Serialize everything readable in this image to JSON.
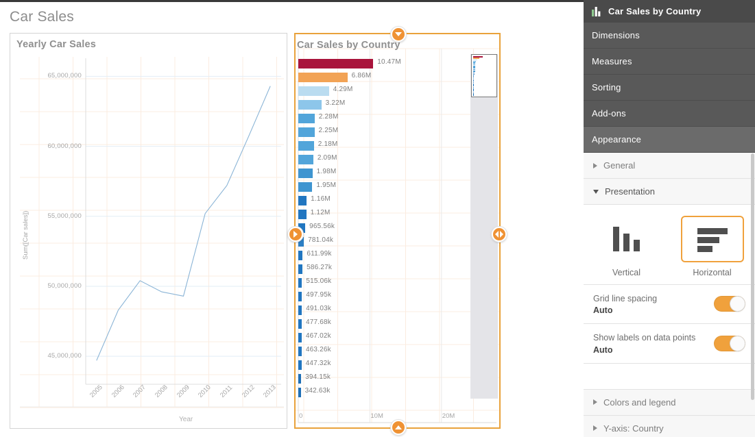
{
  "sheet": {
    "title": "Car Sales"
  },
  "line_object": {
    "title": "Yearly Car Sales"
  },
  "bar_object": {
    "title": "Car Sales by Country"
  },
  "panel": {
    "header_title": "Car Sales by Country",
    "header_icon": "bar-chart-icon",
    "accordion": [
      {
        "label": "Dimensions",
        "active": false
      },
      {
        "label": "Measures",
        "active": false
      },
      {
        "label": "Sorting",
        "active": false
      },
      {
        "label": "Add-ons",
        "active": false
      },
      {
        "label": "Appearance",
        "active": true
      }
    ],
    "sub_sections": [
      {
        "label": "General",
        "expanded": false
      },
      {
        "label": "Presentation",
        "expanded": true
      }
    ],
    "orientation": {
      "options": [
        {
          "label": "Vertical",
          "selected": false,
          "icon": "vertical-bars-icon"
        },
        {
          "label": "Horizontal",
          "selected": true,
          "icon": "horizontal-bars-icon"
        }
      ]
    },
    "settings": [
      {
        "label": "Grid line spacing",
        "value": "Auto",
        "toggle": "on"
      },
      {
        "label": "Show labels on data points",
        "value": "Auto",
        "toggle": "on"
      }
    ],
    "collapsed_sections": [
      {
        "label": "Colors and legend"
      },
      {
        "label": "Y-axis: Country"
      }
    ],
    "accent_color": "#f0a13c",
    "header_bg": "#4a4a4a"
  },
  "chart_data": [
    {
      "type": "line",
      "title": "Yearly Car Sales",
      "xlabel": "Year",
      "ylabel": "Sum([Car sales])",
      "grid": true,
      "x": [
        "2005",
        "2006",
        "2007",
        "2008",
        "2009",
        "2010",
        "2011",
        "2012",
        "2013"
      ],
      "values": [
        44700000,
        48300000,
        50400000,
        49600000,
        49300000,
        55200000,
        57200000,
        60700000,
        64300000
      ],
      "ytick_labels": [
        "65,000,000",
        "60,000,000",
        "55,000,000",
        "50,000,000",
        "45,000,000"
      ],
      "ytick_values": [
        65000000,
        60000000,
        55000000,
        50000000,
        45000000
      ],
      "ylim": [
        43000000,
        66000000
      ],
      "series_color": "#8ab4d6"
    },
    {
      "type": "bar",
      "title": "Car Sales by Country",
      "xlabel": "",
      "ylabel": "Country",
      "orientation": "horizontal",
      "grid": true,
      "xtick_labels": [
        "0",
        "10M",
        "20M"
      ],
      "xtick_values": [
        0,
        10000000,
        20000000
      ],
      "xlim": [
        0,
        25000000
      ],
      "data_labels": [
        "10.47M",
        "6.86M",
        "4.29M",
        "3.22M",
        "2.28M",
        "2.25M",
        "2.18M",
        "2.09M",
        "1.98M",
        "1.95M",
        "1.16M",
        "1.12M",
        "965.56k",
        "781.04k",
        "611.99k",
        "586.27k",
        "515.06k",
        "497.95k",
        "491.03k",
        "477.68k",
        "467.02k",
        "463.26k",
        "447.32k",
        "394.15k",
        "342.63k"
      ],
      "values": [
        10470000,
        6860000,
        4290000,
        3220000,
        2280000,
        2250000,
        2180000,
        2090000,
        1980000,
        1950000,
        1160000,
        1120000,
        965560,
        781040,
        611990,
        586270,
        515060,
        497950,
        491030,
        477680,
        467020,
        463260,
        447320,
        394150,
        342630
      ],
      "bar_colors": [
        "#a9143c",
        "#f2a355",
        "#badcf0",
        "#8dc6ea",
        "#52a5da",
        "#52a5da",
        "#52a5da",
        "#52a5da",
        "#3f95d0",
        "#3f95d0",
        "#2176c0",
        "#2176c0",
        "#2176c0",
        "#2d7fc4",
        "#2176c0",
        "#2176c0",
        "#2176c0",
        "#2176c0",
        "#2176c0",
        "#2176c0",
        "#2176c0",
        "#2176c0",
        "#2176c0",
        "#1f6fb5",
        "#1f6fb5"
      ]
    }
  ]
}
